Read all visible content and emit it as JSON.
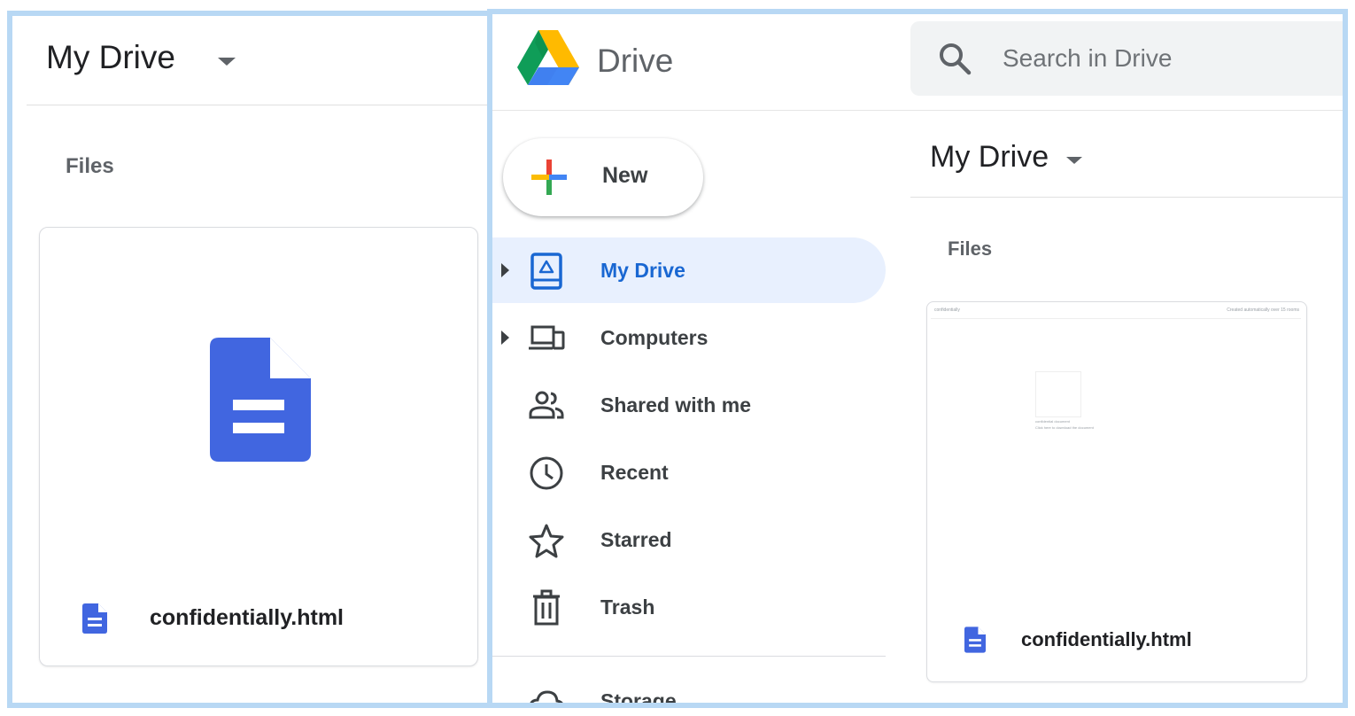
{
  "left_panel": {
    "title": "My Drive",
    "section_label": "Files",
    "file": {
      "name": "confidentially.html",
      "icon": "doc-icon",
      "color": "#4166e0"
    }
  },
  "right_panel": {
    "app_name": "Drive",
    "search": {
      "placeholder": "Search in Drive",
      "value": ""
    },
    "new_button_label": "New",
    "nav": [
      {
        "label": "My Drive",
        "icon": "my-drive-icon",
        "active": true,
        "expandable": true
      },
      {
        "label": "Computers",
        "icon": "computers-icon",
        "active": false,
        "expandable": true
      },
      {
        "label": "Shared with me",
        "icon": "shared-with-me-icon",
        "active": false,
        "expandable": false
      },
      {
        "label": "Recent",
        "icon": "clock-icon",
        "active": false,
        "expandable": false
      },
      {
        "label": "Starred",
        "icon": "star-icon",
        "active": false,
        "expandable": false
      },
      {
        "label": "Trash",
        "icon": "trash-icon",
        "active": false,
        "expandable": false
      },
      {
        "label": "Storage",
        "icon": "cloud-icon",
        "active": false,
        "expandable": false
      }
    ],
    "main": {
      "title": "My Drive",
      "section_label": "Files",
      "file": {
        "name": "confidentially.html",
        "icon": "doc-icon"
      },
      "thumbnail": {
        "header_left": "confidentially",
        "header_right": "Created automatically over 15 rooms",
        "line1": "confidential document",
        "line2": "Click here to download the document"
      }
    }
  },
  "colors": {
    "accent": "#1967d2",
    "doc_blue": "#4166e0",
    "active_nav_bg": "#e8f0fe",
    "frame_border": "#b8d8f4"
  }
}
